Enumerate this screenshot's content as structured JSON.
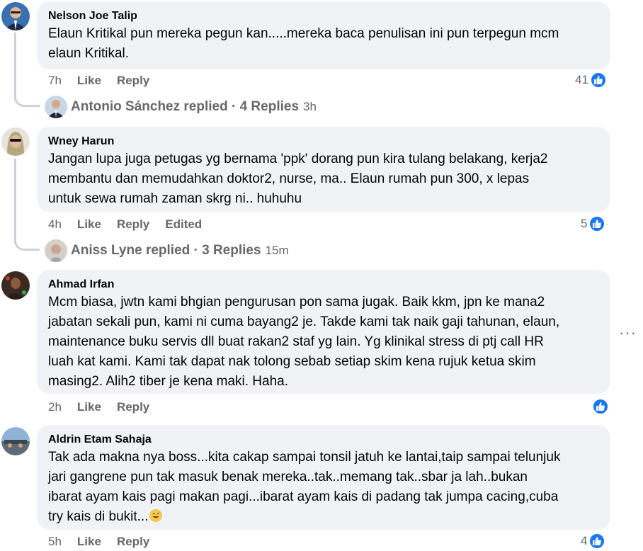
{
  "comments": [
    {
      "author": "Nelson Joe Talip",
      "lines": [
        "Elaun Kritikal pun mereka pegun kan.....mereka baca penulisan ini pun terpegun mcm",
        "elaun Kritikal."
      ],
      "time": "7h",
      "like": "Like",
      "reply": "Reply",
      "likes": "41",
      "replies": {
        "text": "Antonio Sánchez replied · 4 Replies",
        "time": "3h"
      }
    },
    {
      "author": "Wney Harun",
      "lines": [
        "Jangan lupa juga petugas yg bernama 'ppk' dorang pun kira tulang belakang, kerja2",
        "membantu dan memudahkan doktor2, nurse, ma.. Elaun rumah pun 300, x lepas",
        "untuk sewa rumah zaman skrg ni.. huhuhu"
      ],
      "time": "4h",
      "like": "Like",
      "reply": "Reply",
      "edited": "Edited",
      "likes": "5",
      "replies": {
        "text": "Aniss Lyne replied · 3 Replies",
        "time": "15m"
      }
    },
    {
      "author": "Ahmad Irfan",
      "lines": [
        "Mcm biasa, jwtn kami bhgian pengurusan pon sama jugak. Baik kkm, jpn ke mana2",
        "jabatan sekali pun, kami ni cuma bayang2 je. Takde kami tak naik gaji tahunan, elaun,",
        "maintenance buku servis dll buat rakan2 staf yg lain. Yg klinikal stress di ptj call HR",
        "luah kat kami. Kami tak dapat nak tolong sebab setiap skim kena rujuk ketua skim",
        "masing2. Alih2 tiber je kena maki. Haha."
      ],
      "time": "2h",
      "like": "Like",
      "reply": "Reply",
      "likes": ""
    },
    {
      "author": "Aldrin Etam Sahaja",
      "lines": [
        "Tak ada makna nya boss...kita cakap sampai tonsil jatuh ke lantai,taip sampai telunjuk",
        "jari gangrene pun tak masuk benak mereka..tak..memang tak..sbar ja lah..bukan",
        "ibarat ayam kais pagi makan pagi...ibarat ayam kais di padang tak jumpa cacing,cuba",
        "try kais di bukit..."
      ],
      "time": "5h",
      "like": "Like",
      "reply": "Reply",
      "likes": "4"
    }
  ],
  "more_menu": "···",
  "colors": {
    "bubble": "#f0f2f5",
    "like_blue": "#1877f2",
    "meta": "#65676b"
  },
  "icons": [
    "like-thumb-icon",
    "more-options-icon",
    "grinning-sweat-emoji-icon"
  ]
}
